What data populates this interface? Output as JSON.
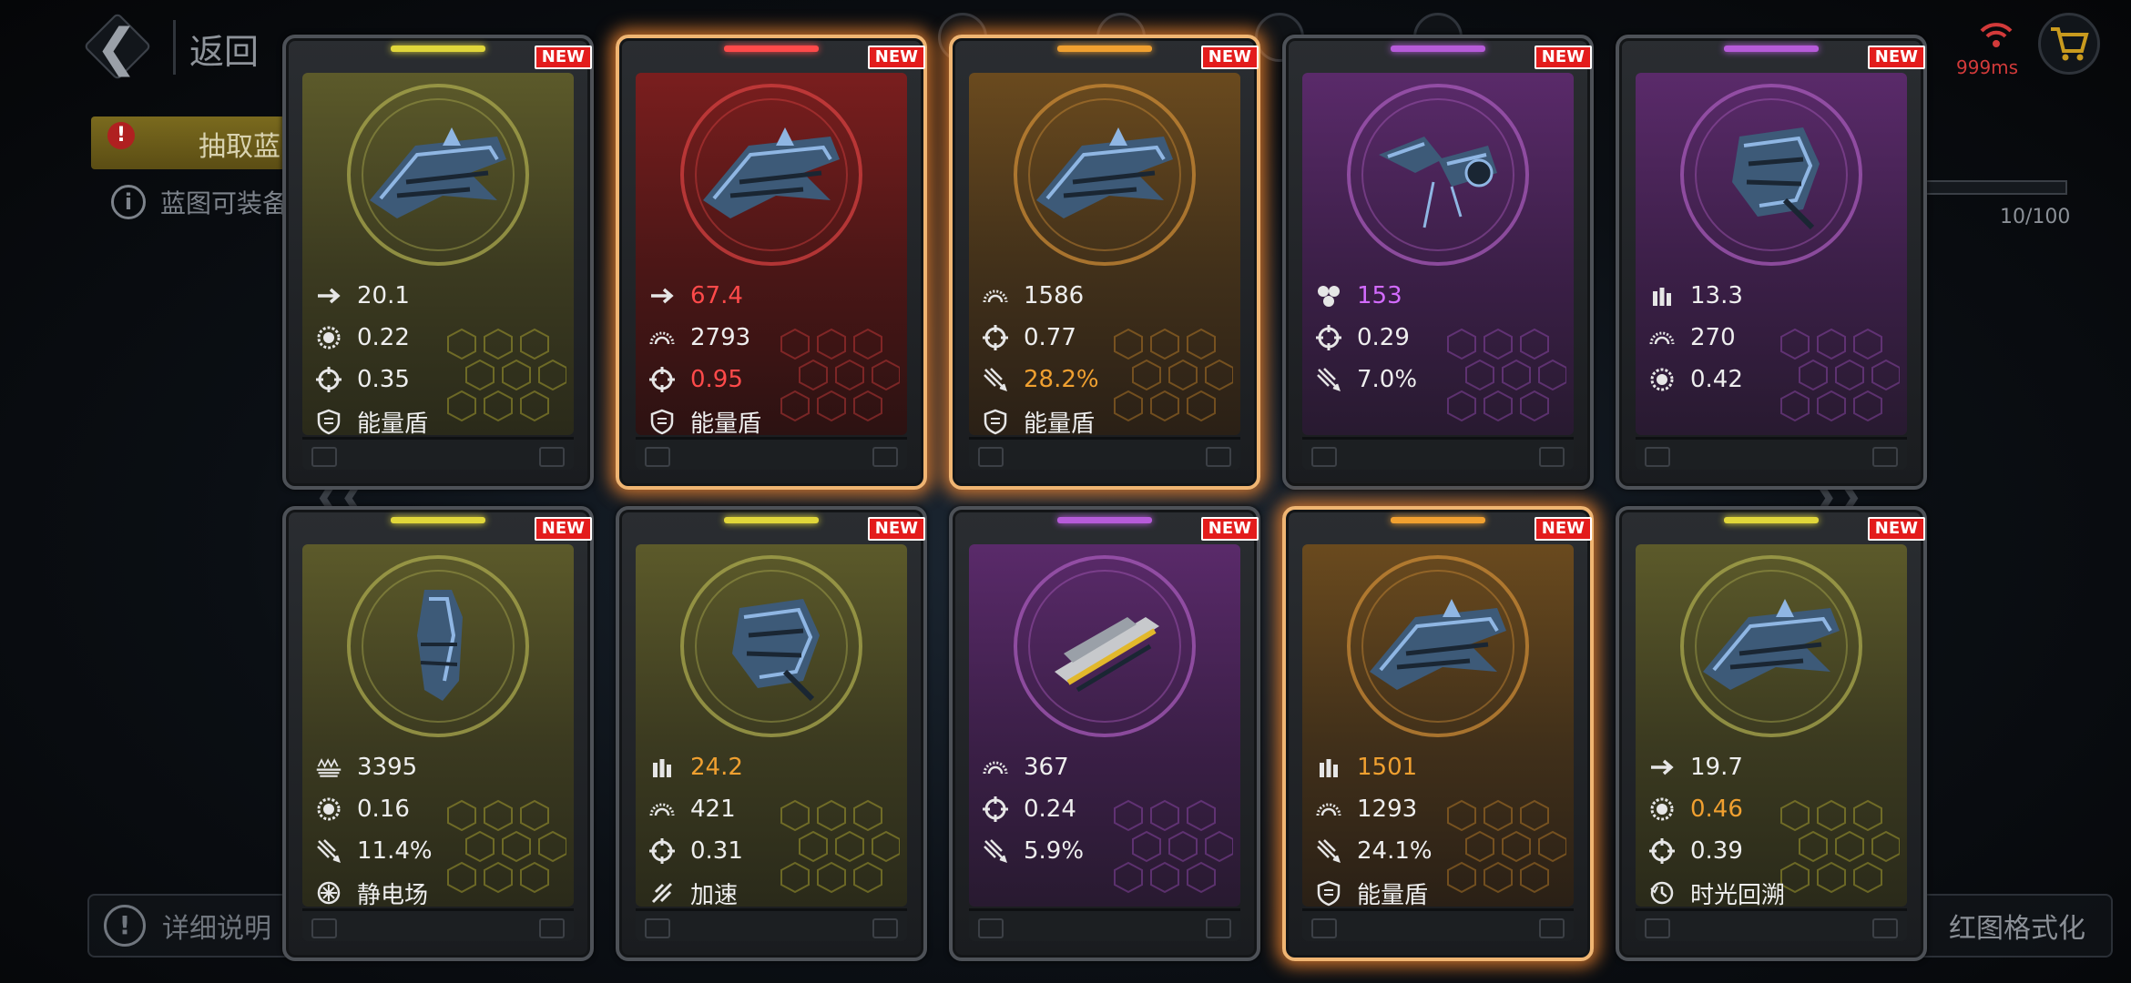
{
  "header": {
    "back_label": "返回",
    "ping": "999ms"
  },
  "left_panel": {
    "extract_tab_label": "抽取蓝",
    "info_text": "蓝图可装备"
  },
  "progress": {
    "text": "10/100",
    "fraction": 0.1
  },
  "bottom": {
    "detail_label": "详细说明",
    "format_label": "红图格式化"
  },
  "colors": {
    "yellow": "#e0d63a",
    "red": "#ff4a4a",
    "orange": "#f0a030",
    "purple": "#b65bd9",
    "glow": "#f0b572",
    "new_badge": "#e31c1c"
  },
  "new_badge_text": "NEW",
  "cards": [
    {
      "rarity": "yellow",
      "glow": false,
      "ship_icon": "battleship-icon",
      "stats": [
        {
          "icon": "speed-arrow-icon",
          "value": "20.1",
          "highlight": ""
        },
        {
          "icon": "shield-ring-icon",
          "value": "0.22",
          "highlight": ""
        },
        {
          "icon": "crosshair-icon",
          "value": "0.35",
          "highlight": ""
        },
        {
          "icon": "shield-badge-icon",
          "value": "能量盾",
          "highlight": ""
        }
      ]
    },
    {
      "rarity": "red",
      "glow": true,
      "ship_icon": "battleship-icon",
      "stats": [
        {
          "icon": "speed-arrow-icon",
          "value": "67.4",
          "highlight": "red"
        },
        {
          "icon": "armor-dial-icon",
          "value": "2793",
          "highlight": ""
        },
        {
          "icon": "crosshair-icon",
          "value": "0.95",
          "highlight": "red"
        },
        {
          "icon": "shield-badge-icon",
          "value": "能量盾",
          "highlight": ""
        }
      ]
    },
    {
      "rarity": "orange",
      "glow": true,
      "ship_icon": "cruiser-icon",
      "stats": [
        {
          "icon": "armor-dial-icon",
          "value": "1586",
          "highlight": ""
        },
        {
          "icon": "crosshair-icon",
          "value": "0.77",
          "highlight": ""
        },
        {
          "icon": "missile-burst-icon",
          "value": "28.2%",
          "highlight": "orange"
        },
        {
          "icon": "shield-badge-icon",
          "value": "能量盾",
          "highlight": ""
        }
      ]
    },
    {
      "rarity": "purple",
      "glow": false,
      "ship_icon": "fighter-icon",
      "stats": [
        {
          "icon": "cluster-icon",
          "value": "153",
          "highlight": "purple"
        },
        {
          "icon": "crosshair-icon",
          "value": "0.29",
          "highlight": ""
        },
        {
          "icon": "missile-burst-icon",
          "value": "7.0%",
          "highlight": ""
        }
      ]
    },
    {
      "rarity": "purple",
      "glow": false,
      "ship_icon": "drone-icon",
      "stats": [
        {
          "icon": "ammo-icon",
          "value": "13.3",
          "highlight": ""
        },
        {
          "icon": "armor-dial-icon",
          "value": "270",
          "highlight": ""
        },
        {
          "icon": "shield-ring-icon",
          "value": "0.42",
          "highlight": ""
        }
      ]
    },
    {
      "rarity": "yellow",
      "glow": false,
      "ship_icon": "pod-icon",
      "stats": [
        {
          "icon": "hull-icon",
          "value": "3395",
          "highlight": ""
        },
        {
          "icon": "shield-ring-icon",
          "value": "0.16",
          "highlight": ""
        },
        {
          "icon": "missile-burst-icon",
          "value": "11.4%",
          "highlight": ""
        },
        {
          "icon": "static-field-icon",
          "value": "静电场",
          "highlight": ""
        }
      ]
    },
    {
      "rarity": "yellow",
      "glow": false,
      "ship_icon": "drone-icon",
      "stats": [
        {
          "icon": "ammo-icon",
          "value": "24.2",
          "highlight": "orange"
        },
        {
          "icon": "armor-dial-icon",
          "value": "421",
          "highlight": ""
        },
        {
          "icon": "crosshair-icon",
          "value": "0.31",
          "highlight": ""
        },
        {
          "icon": "boost-icon",
          "value": "加速",
          "highlight": ""
        }
      ]
    },
    {
      "rarity": "purple",
      "glow": false,
      "ship_icon": "gunship-icon",
      "stats": [
        {
          "icon": "armor-dial-icon",
          "value": "367",
          "highlight": ""
        },
        {
          "icon": "crosshair-icon",
          "value": "0.24",
          "highlight": ""
        },
        {
          "icon": "missile-burst-icon",
          "value": "5.9%",
          "highlight": ""
        }
      ]
    },
    {
      "rarity": "orange",
      "glow": true,
      "ship_icon": "cruiser-icon",
      "stats": [
        {
          "icon": "ammo-icon",
          "value": "1501",
          "highlight": "orange"
        },
        {
          "icon": "armor-dial-icon",
          "value": "1293",
          "highlight": ""
        },
        {
          "icon": "missile-burst-icon",
          "value": "24.1%",
          "highlight": ""
        },
        {
          "icon": "shield-badge-icon",
          "value": "能量盾",
          "highlight": ""
        }
      ]
    },
    {
      "rarity": "yellow",
      "glow": false,
      "ship_icon": "frigate-icon",
      "stats": [
        {
          "icon": "speed-arrow-icon",
          "value": "19.7",
          "highlight": ""
        },
        {
          "icon": "shield-ring-icon",
          "value": "0.46",
          "highlight": "orange"
        },
        {
          "icon": "crosshair-icon",
          "value": "0.39",
          "highlight": ""
        },
        {
          "icon": "time-rewind-icon",
          "value": "时光回溯",
          "highlight": ""
        }
      ]
    }
  ]
}
